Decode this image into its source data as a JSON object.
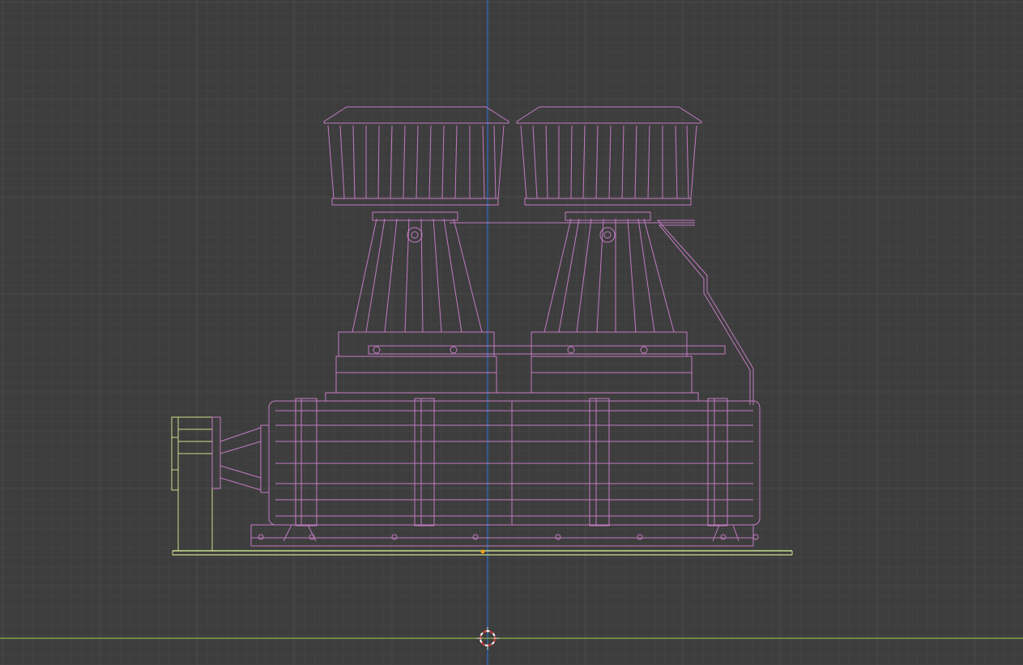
{
  "viewport": {
    "mode": "wireframe-orthographic-front",
    "colors": {
      "background": "#3d3d3d",
      "grid_minor": "#454545",
      "grid_major": "#505050",
      "axis_vertical": "#2f6fc9",
      "axis_horizontal": "#8fb34a",
      "selected_wire": "#c37bc2",
      "active_wire": "#c9e08a",
      "origin": "#f0a020",
      "cursor_red": "#d63a3a",
      "cursor_white": "#ffffff"
    },
    "icons": {
      "cursor": "3d-cursor-icon",
      "origin": "object-origin-icon"
    }
  }
}
